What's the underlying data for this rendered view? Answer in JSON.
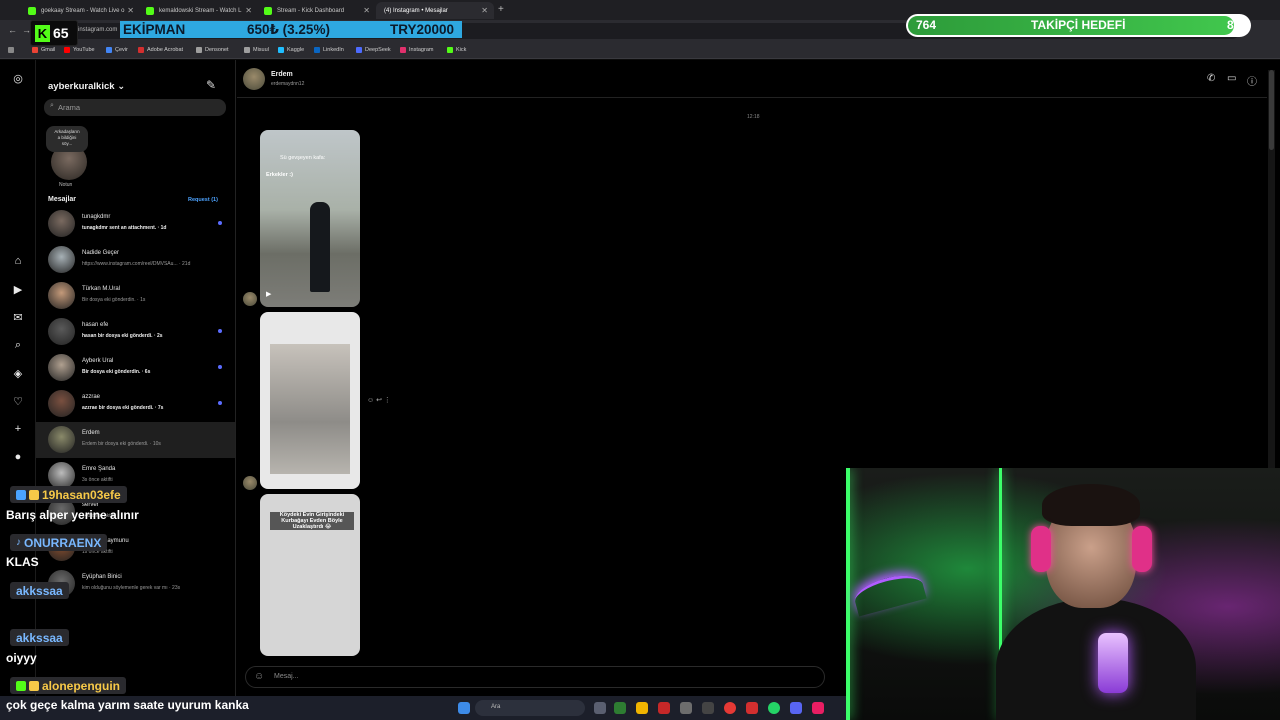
{
  "browser": {
    "tabs": [
      {
        "label": "goekaay Stream - Watch Live o",
        "x": 0
      },
      {
        "label": "kemaldowski Stream - Watch L",
        "x": 0
      },
      {
        "label": "Stream - Kick Dashboard",
        "x": 0
      },
      {
        "label": "(4) Instagram • Mesajlar",
        "x": 0
      }
    ],
    "url": "instagram.com",
    "bookmarks": [
      "Gmail",
      "YouTube",
      "Çevir",
      "Adobe Acrobat",
      "Densonet",
      "Misuul",
      "Kaggle",
      "LinkedIn",
      "DeepSeek",
      "Instagram",
      "Kick"
    ]
  },
  "overlay": {
    "kick_count": "65",
    "ticker": {
      "left": "EKİPMAN",
      "mid": "650₺ (3.25%)",
      "right": "TRY20000"
    },
    "goal": {
      "current": "764",
      "label": "TAKİPÇİ HEDEFİ",
      "target": "800",
      "progress": 0.955
    }
  },
  "instagram": {
    "username": "ayberkuralkick",
    "search_placeholder": "Arama",
    "note_bubble": "Arkadaşların\na bildiğini\nsöy...",
    "note_label": "Notun",
    "messages_heading": "Mesajlar",
    "request_label": "Request (1)",
    "conversations": [
      {
        "name": "tunagkdmr",
        "preview": "tunagkdmr sent an attachment. · 1d",
        "bold": true,
        "unread": true
      },
      {
        "name": "Nadide Geçer",
        "preview": "https://www.instagram.com/reel/DMVSAu... · 21d",
        "bold": false,
        "unread": false
      },
      {
        "name": "Türkan M.Ural",
        "preview": "Bir dosya eki gönderdin. · 1s",
        "bold": false,
        "unread": false
      },
      {
        "name": "hasan efe",
        "preview": "hasan bir dosya eki gönderdi. · 2s",
        "bold": true,
        "unread": true
      },
      {
        "name": "Ayberk Ural",
        "preview": "Bir dosya eki gönderdin. · 6s",
        "bold": true,
        "unread": true
      },
      {
        "name": "azzrae",
        "preview": "azzrae bir dosya eki gönderdi. · 7s",
        "bold": true,
        "unread": true
      },
      {
        "name": "Erdem",
        "preview": "Erdem bir dosya eki gönderdi. · 10s",
        "bold": false,
        "unread": false
      },
      {
        "name": "Emre Şanda",
        "preview": "3s önce aktifti",
        "bold": false,
        "unread": false
      },
      {
        "name": "server",
        "preview": "14d önce aktifti",
        "bold": false,
        "unread": false
      },
      {
        "name": "magra_maymunu",
        "preview": "1s önce aktifti",
        "bold": false,
        "unread": false
      },
      {
        "name": "Eyüphan Binici",
        "preview": "kim olduğunu söylemenle gerek var mı · 23s",
        "bold": false,
        "unread": false
      }
    ],
    "thread": {
      "name": "Erdem",
      "handle": "erdemaydnn12",
      "timestamp": "12:18",
      "reel1_caption": "Erkekler :)",
      "reel1_sub": "Sü gevşeyen kafa:",
      "reel3_caption": "Köydeki Evin Girişindeki Kurbağayı Evden Böyle Uzaklaştırdı 😂",
      "composer_placeholder": "Mesaj..."
    }
  },
  "taskbar": {
    "search_placeholder": "Ara"
  },
  "chat": [
    {
      "user": "19hasan03efe",
      "message": "Barış alper yerine alınır",
      "color": "#f7c948"
    },
    {
      "user": "ONURRAENX",
      "message": "KLAS",
      "color": "#79b8ff"
    },
    {
      "user": "akkssaa",
      "message": "",
      "color": "#79b8ff"
    },
    {
      "user": "akkssaa",
      "message": "oiyyy",
      "color": "#79b8ff"
    },
    {
      "user": "alonepenguin",
      "message": "çok geçe kalma yarım saate uyurum kanka",
      "color": "#f7c948"
    }
  ],
  "colors": {
    "accent_kick": "#53fc18",
    "ig_unread": "#5b6cff",
    "ticker_bg": "#2ea8e0"
  }
}
